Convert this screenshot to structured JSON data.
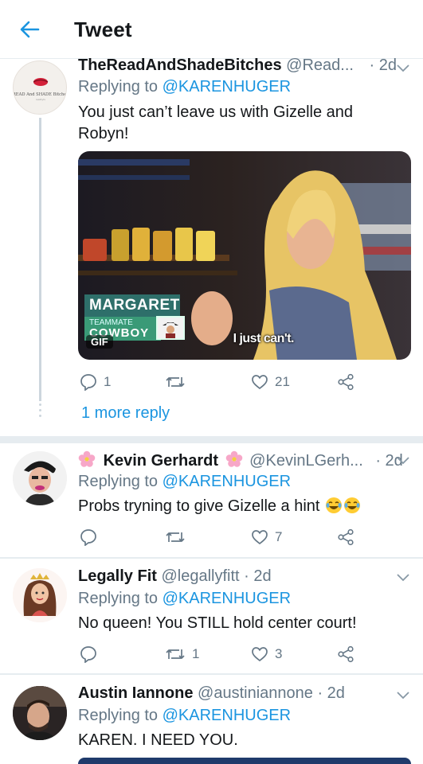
{
  "header": {
    "title": "Tweet"
  },
  "tweets": [
    {
      "name": "TheReadAndShadeBitches",
      "handle": "@Read...",
      "time": "· 2d",
      "replying_prefix": "Replying to",
      "replying_to": "@KARENHUGER",
      "text": "You just can’t leave us with Gizelle and Robyn!",
      "avatar_text": "READ And SHADE Bitches",
      "gif": {
        "caption": "I just can't.",
        "badge": "GIF",
        "lower_third_name": "MARGARET",
        "lower_third_role": "TEAMMATE",
        "lower_third_show": "COWBOY"
      },
      "stats": {
        "replies": "1",
        "retweets": "",
        "likes": "21"
      },
      "more_replies": "1 more reply"
    },
    {
      "name": "Kevin Gerhardt",
      "handle": "@KevinLGerh...",
      "time": "· 2d",
      "replying_prefix": "Replying to",
      "replying_to": "@KARENHUGER",
      "text": "Probs tryning to give Gizelle a hint",
      "stats": {
        "replies": "",
        "retweets": "",
        "likes": "7"
      }
    },
    {
      "name": "Legally Fit",
      "handle": "@legallyfitt",
      "time": "· 2d",
      "replying_prefix": "Replying to",
      "replying_to": "@KARENHUGER",
      "text": "No queen! You STILL hold center court!",
      "stats": {
        "replies": "",
        "retweets": "1",
        "likes": "3"
      }
    },
    {
      "name": "Austin Iannone",
      "handle": "@austiniannone",
      "time": "· 2d",
      "replying_prefix": "Replying to",
      "replying_to": "@KARENHUGER",
      "text": "KAREN. I NEED YOU."
    }
  ],
  "icons": {
    "back": "arrow-left-icon",
    "reply": "speech-bubble-icon",
    "retweet": "retweet-arrows-icon",
    "like": "heart-icon",
    "share": "share-nodes-icon",
    "more": "chevron-down-icon",
    "decoration": "cherry-blossom-emoji",
    "laugh": "tears-of-joy-emoji"
  },
  "colors": {
    "accent": "#1b95e0",
    "muted": "#657786",
    "text": "#14171a",
    "divider": "#e6ecf0"
  }
}
